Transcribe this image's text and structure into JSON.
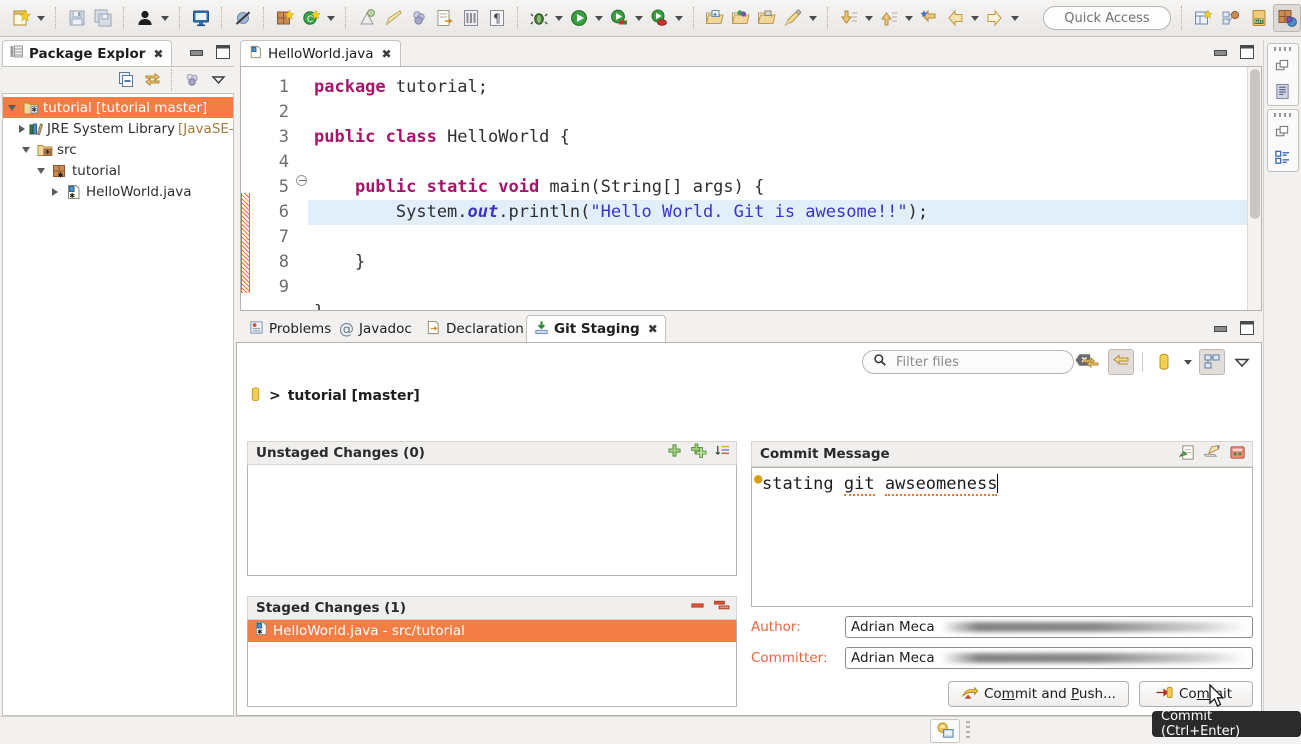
{
  "toolbar": {
    "quick_access_placeholder": "Quick Access",
    "groups": [
      {
        "items": [
          {
            "icon": "new-wizard-icon",
            "name": "new-button",
            "arrow": true
          }
        ]
      },
      {
        "items": [
          {
            "icon": "save-icon",
            "name": "save-button",
            "arrow": false
          },
          {
            "icon": "save-all-icon",
            "name": "save-all-button",
            "arrow": false
          }
        ]
      },
      {
        "items": [
          {
            "icon": "user-icon",
            "name": "user-button",
            "arrow": true
          }
        ]
      },
      {
        "items": [
          {
            "icon": "console-icon",
            "name": "open-console-button",
            "arrow": false
          }
        ]
      },
      {
        "items": [
          {
            "icon": "skip-breakpoints-icon",
            "name": "skip-all-breakpoints-button",
            "arrow": false
          }
        ]
      },
      {
        "items": [
          {
            "icon": "new-package-icon",
            "name": "new-java-package-button",
            "arrow": false
          },
          {
            "icon": "new-class-icon",
            "name": "new-java-class-button",
            "arrow": true
          }
        ]
      },
      {
        "items": [
          {
            "icon": "new-annotation-icon",
            "name": "new-annotation-button",
            "arrow": false
          },
          {
            "icon": "edit-icon",
            "name": "edit-button",
            "arrow": false
          },
          {
            "icon": "new-interface-icon",
            "name": "new-interface-button",
            "arrow": false
          },
          {
            "icon": "export-doc-icon",
            "name": "export-doc-button",
            "arrow": false
          },
          {
            "icon": "open-type-icon",
            "name": "open-type-button",
            "arrow": false
          },
          {
            "icon": "paragraph-icon",
            "name": "toggle-whitespace-button",
            "arrow": false
          }
        ]
      },
      {
        "items": [
          {
            "icon": "debug-icon",
            "name": "debug-button",
            "arrow": true
          },
          {
            "icon": "run-icon",
            "name": "run-button",
            "arrow": true
          },
          {
            "icon": "coverage-icon",
            "name": "coverage-button",
            "arrow": true
          },
          {
            "icon": "run-external-icon",
            "name": "external-tools-button",
            "arrow": true
          }
        ]
      },
      {
        "items": [
          {
            "icon": "open-folder-blue-icon",
            "name": "open-resource-button",
            "arrow": false
          },
          {
            "icon": "open-folder-multi-icon",
            "name": "open-perspective-button",
            "arrow": false
          },
          {
            "icon": "open-folder-grey-icon",
            "name": "open-task-button",
            "arrow": false
          },
          {
            "icon": "pencil-icon",
            "name": "annotate-button",
            "arrow": true
          }
        ]
      },
      {
        "items": [
          {
            "icon": "next-annotation-icon",
            "name": "next-annotation-button",
            "arrow": true
          },
          {
            "icon": "previous-annotation-icon",
            "name": "previous-annotation-button",
            "arrow": true
          },
          {
            "icon": "last-edit-location-icon",
            "name": "last-edit-location-button",
            "arrow": false
          },
          {
            "icon": "back-icon",
            "name": "back-button",
            "arrow": true
          },
          {
            "icon": "forward-icon",
            "name": "forward-button",
            "arrow": true
          }
        ]
      }
    ],
    "perspectives": [
      {
        "icon": "open-perspective-icon",
        "name": "open-perspective-button",
        "active": false
      },
      {
        "icon": "java-hierarchy-icon",
        "name": "perspective-java-browsing",
        "active": false
      },
      {
        "icon": "git-perspective-icon",
        "name": "perspective-git",
        "active": false
      },
      {
        "icon": "java-perspective-icon",
        "name": "perspective-java",
        "active": true
      }
    ]
  },
  "package_explorer": {
    "tab_title": "Package Explor",
    "toolbar_buttons": [
      {
        "name": "collapse-all-button",
        "icon": "collapse-all-icon"
      },
      {
        "name": "link-with-editor-button",
        "icon": "link-editor-icon"
      },
      {
        "name": "focus-on-active-task-button",
        "icon": "focus-task-icon"
      },
      {
        "name": "view-menu-button",
        "icon": "view-menu-icon"
      }
    ],
    "tree": [
      {
        "label": "tutorial [tutorial master]",
        "icon": "java-project-icon",
        "indent": 0,
        "twisty": "open",
        "selected": true,
        "suffix": ""
      },
      {
        "label": "JRE System Library ",
        "icon": "library-icon",
        "indent": 1,
        "twisty": "closed",
        "selected": false,
        "suffix": "[JavaSE-"
      },
      {
        "label": "src",
        "icon": "source-folder-icon",
        "indent": 1,
        "twisty": "open",
        "selected": false,
        "suffix": ""
      },
      {
        "label": "tutorial",
        "icon": "package-icon",
        "indent": 2,
        "twisty": "open",
        "selected": false,
        "suffix": ""
      },
      {
        "label": "HelloWorld.java",
        "icon": "java-file-icon",
        "indent": 3,
        "twisty": "closed",
        "selected": false,
        "suffix": ""
      }
    ]
  },
  "editor": {
    "tab_title": "HelloWorld.java",
    "tab_icon": "java-file-icon",
    "close_glyph": "✕",
    "lines": [
      {
        "num": "1",
        "tokens": [
          {
            "t": "package",
            "c": "kw"
          },
          {
            "t": " tutorial;",
            "c": ""
          }
        ],
        "highlight": false
      },
      {
        "num": "2",
        "tokens": [],
        "highlight": false
      },
      {
        "num": "3",
        "tokens": [
          {
            "t": "public class",
            "c": "kw"
          },
          {
            "t": " HelloWorld {",
            "c": ""
          }
        ],
        "highlight": false
      },
      {
        "num": "4",
        "tokens": [],
        "highlight": false
      },
      {
        "num": "5",
        "tokens": [
          {
            "t": "    ",
            "c": ""
          },
          {
            "t": "public static void",
            "c": "kw"
          },
          {
            "t": " main(String[] args) {",
            "c": ""
          }
        ],
        "highlight": false
      },
      {
        "num": "6",
        "tokens": [
          {
            "t": "        System.",
            "c": ""
          },
          {
            "t": "out",
            "c": "fld"
          },
          {
            "t": ".println(",
            "c": ""
          },
          {
            "t": "\"Hello World. Git is awesome!!\"",
            "c": "str"
          },
          {
            "t": ");",
            "c": ""
          }
        ],
        "highlight": true
      },
      {
        "num": "7",
        "tokens": [],
        "highlight": false
      },
      {
        "num": "8",
        "tokens": [
          {
            "t": "    }",
            "c": ""
          }
        ],
        "highlight": false
      },
      {
        "num": "9",
        "tokens": [],
        "highlight": false
      },
      {
        "num": "",
        "tokens": [
          {
            "t": "}",
            "c": ""
          }
        ],
        "highlight": false
      }
    ]
  },
  "bottom_tabs": [
    {
      "label": "Problems",
      "icon": "problems-icon",
      "active": false
    },
    {
      "label": "Javadoc",
      "icon": "javadoc-icon",
      "active": false
    },
    {
      "label": "Declaration",
      "icon": "declaration-icon",
      "active": false
    },
    {
      "label": "Git Staging",
      "icon": "git-staging-icon",
      "active": true
    }
  ],
  "git_staging": {
    "filter": {
      "placeholder": "Filter files",
      "value": "",
      "icon": "search-icon",
      "clear_icon": "clear-icon"
    },
    "toolbar_buttons": [
      {
        "name": "refresh-button",
        "icon": "refresh-icon",
        "pressed": false
      },
      {
        "name": "link-selection-button",
        "icon": "link-selection-icon",
        "pressed": true
      },
      {
        "name": "repository-selector-button",
        "icon": "repository-icon",
        "pressed": false
      },
      {
        "name": "presentation-button",
        "icon": "presentation-icon",
        "pressed": false
      },
      {
        "name": "view-menu-button",
        "icon": "view-menu-icon",
        "pressed": false
      }
    ],
    "repository": {
      "icon": "repository-icon",
      "separator": ">",
      "label": "tutorial [master]"
    },
    "unstaged": {
      "title": "Unstaged Changes (0)",
      "tools": [
        {
          "name": "stage-selected-button",
          "icon": "add-icon"
        },
        {
          "name": "stage-all-button",
          "icon": "add-all-icon"
        },
        {
          "name": "sort-button",
          "icon": "sort-icon"
        }
      ],
      "rows": []
    },
    "staged": {
      "title": "Staged Changes (1)",
      "tools": [
        {
          "name": "unstage-selected-button",
          "icon": "remove-icon"
        },
        {
          "name": "unstage-all-button",
          "icon": "remove-all-icon"
        }
      ],
      "rows": [
        {
          "icon": "java-file-icon",
          "label": "HelloWorld.java - src/tutorial",
          "selected": true
        }
      ]
    },
    "commit_message": {
      "title": "Commit Message",
      "tools": [
        {
          "name": "add-signed-off-by-button",
          "icon": "signed-off-icon"
        },
        {
          "name": "add-change-id-button",
          "icon": "change-id-icon"
        },
        {
          "name": "amend-commit-button",
          "icon": "amend-icon"
        }
      ],
      "text_parts": [
        {
          "t": "stating ",
          "spell": false
        },
        {
          "t": "git",
          "spell": true
        },
        {
          "t": " ",
          "spell": false
        },
        {
          "t": "awseomeness",
          "spell": true
        }
      ],
      "value": "stating git awseomeness"
    },
    "author": {
      "label": "Author:",
      "value": "Adrian Meca",
      "redacted": true
    },
    "committer": {
      "label": "Committer:",
      "value": "Adrian Meca",
      "redacted": true
    },
    "buttons": [
      {
        "name": "commit-and-push-button",
        "icon": "push-icon",
        "pre": "Co",
        "mnemonic": "m",
        "mid": "mit and ",
        "mnemonic2": "P",
        "post": "ush..."
      },
      {
        "name": "commit-button",
        "icon": "commit-icon",
        "pre": "Co",
        "mnemonic": "m",
        "mid": "mit",
        "mnemonic2": "",
        "post": ""
      }
    ]
  },
  "tooltip": {
    "text": "Commit (Ctrl+Enter)"
  },
  "right_stacks": [
    {
      "grip": "restore-grip",
      "icons": [
        {
          "name": "restore-icon",
          "icon": "restore-icon"
        },
        {
          "name": "outline-view-icon",
          "icon": "outline-view-icon"
        }
      ]
    },
    {
      "grip": "restore-grip",
      "icons": [
        {
          "name": "restore-icon",
          "icon": "restore-icon"
        },
        {
          "name": "task-list-icon",
          "icon": "task-list-icon"
        }
      ]
    }
  ],
  "status_bar": {
    "icon": "build-status-icon"
  },
  "colors": {
    "selection_orange": "#f27d45",
    "accent_label": "#e8643c",
    "keyword": "#a6156b",
    "string": "#3a34c8",
    "line_highlight": "#e3eefb",
    "panel_bg": "#f2f1f0"
  }
}
